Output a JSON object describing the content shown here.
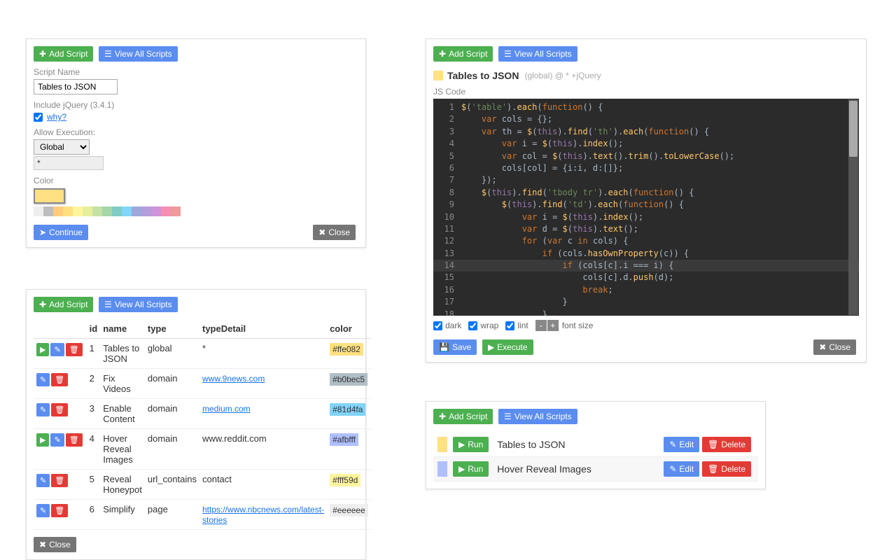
{
  "common": {
    "add_script": "Add Script",
    "view_all_scripts": "View All Scripts",
    "close": "Close",
    "save": "Save",
    "execute": "Execute",
    "continue": "Continue",
    "run": "Run",
    "edit": "Edit",
    "delete": "Delete"
  },
  "panel1": {
    "script_name_label": "Script Name",
    "script_name_value": "Tables to JSON",
    "include_jquery_label": "Include jQuery (3.4.1)",
    "include_jquery_checked": true,
    "why_link": "why?",
    "allow_execution_label": "Allow Execution:",
    "allow_execution_value": "Global",
    "type_detail_value": "*",
    "color_label": "Color",
    "selected_color": "#ffe082",
    "palette": [
      "#eeeeee",
      "#bdbdbd",
      "#ffcc80",
      "#ffe082",
      "#fff59d",
      "#e6ee9c",
      "#c5e1a5",
      "#a5d6a7",
      "#80cbc4",
      "#81d4fa",
      "#9fa8da",
      "#b39ddb",
      "#ce93d8",
      "#f48fb1",
      "#ef9a9a"
    ]
  },
  "panel2": {
    "headers": {
      "id": "id",
      "name": "name",
      "type": "type",
      "typeDetail": "typeDetail",
      "color": "color"
    },
    "rows": [
      {
        "play": true,
        "id": "1",
        "name": "Tables to JSON",
        "type": "global",
        "typeDetail": "*",
        "typeDetailLink": false,
        "color": "#ffe082"
      },
      {
        "play": false,
        "id": "2",
        "name": "Fix Videos",
        "type": "domain",
        "typeDetail": "www.9news.com",
        "typeDetailLink": true,
        "color": "#b0bec5"
      },
      {
        "play": false,
        "id": "3",
        "name": "Enable Content",
        "type": "domain",
        "typeDetail": "medium.com",
        "typeDetailLink": true,
        "color": "#81d4fa"
      },
      {
        "play": true,
        "id": "4",
        "name": "Hover Reveal Images",
        "type": "domain",
        "typeDetail": "www.reddit.com",
        "typeDetailLink": false,
        "color": "#afbfff"
      },
      {
        "play": false,
        "id": "5",
        "name": "Reveal Honeypot",
        "type": "url_contains",
        "typeDetail": "contact",
        "typeDetailLink": false,
        "color": "#fff59d"
      },
      {
        "play": false,
        "id": "6",
        "name": "Simplify",
        "type": "page",
        "typeDetail": "https://www.nbcnews.com/latest-stories",
        "typeDetailLink": true,
        "color": "#eeeeee"
      }
    ]
  },
  "panel3": {
    "title": "Tables to JSON",
    "meta": "(global) @ * +jQuery",
    "js_code_label": "JS Code",
    "options": {
      "dark": "dark",
      "wrap": "wrap",
      "lint": "lint",
      "font_size": "font size",
      "minus": "-",
      "plus": "+"
    },
    "options_checked": {
      "dark": true,
      "wrap": true,
      "lint": true
    },
    "code_lines": [
      [
        [
          "fn",
          "$"
        ],
        [
          "op",
          "("
        ],
        [
          "str",
          "'table'"
        ],
        [
          "op",
          ")."
        ],
        [
          "fn",
          "each"
        ],
        [
          "op",
          "("
        ],
        [
          "kw",
          "function"
        ],
        [
          "op",
          "() {"
        ]
      ],
      [
        [
          "sp",
          "    "
        ],
        [
          "kw",
          "var"
        ],
        [
          "op",
          " cols = {};"
        ]
      ],
      [
        [
          "sp",
          "    "
        ],
        [
          "kw",
          "var"
        ],
        [
          "op",
          " th = "
        ],
        [
          "fn",
          "$"
        ],
        [
          "op",
          "("
        ],
        [
          "this",
          "this"
        ],
        [
          "op",
          ")."
        ],
        [
          "fn",
          "find"
        ],
        [
          "op",
          "("
        ],
        [
          "str",
          "'th'"
        ],
        [
          "op",
          ")."
        ],
        [
          "fn",
          "each"
        ],
        [
          "op",
          "("
        ],
        [
          "kw",
          "function"
        ],
        [
          "op",
          "() {"
        ]
      ],
      [
        [
          "sp",
          "        "
        ],
        [
          "kw",
          "var"
        ],
        [
          "op",
          " i = "
        ],
        [
          "fn",
          "$"
        ],
        [
          "op",
          "("
        ],
        [
          "this",
          "this"
        ],
        [
          "op",
          ")."
        ],
        [
          "fn",
          "index"
        ],
        [
          "op",
          "();"
        ]
      ],
      [
        [
          "sp",
          "        "
        ],
        [
          "kw",
          "var"
        ],
        [
          "op",
          " col = "
        ],
        [
          "fn",
          "$"
        ],
        [
          "op",
          "("
        ],
        [
          "this",
          "this"
        ],
        [
          "op",
          ")."
        ],
        [
          "fn",
          "text"
        ],
        [
          "op",
          "()."
        ],
        [
          "fn",
          "trim"
        ],
        [
          "op",
          "()."
        ],
        [
          "fn",
          "toLowerCase"
        ],
        [
          "op",
          "();"
        ]
      ],
      [
        [
          "sp",
          "        "
        ],
        [
          "op",
          "cols[col] = {i:i, d:[]};"
        ]
      ],
      [
        [
          "sp",
          "    "
        ],
        [
          "op",
          "});"
        ]
      ],
      [
        [
          "sp",
          "    "
        ],
        [
          "fn",
          "$"
        ],
        [
          "op",
          "("
        ],
        [
          "this",
          "this"
        ],
        [
          "op",
          ")."
        ],
        [
          "fn",
          "find"
        ],
        [
          "op",
          "("
        ],
        [
          "str",
          "'tbody tr'"
        ],
        [
          "op",
          ")."
        ],
        [
          "fn",
          "each"
        ],
        [
          "op",
          "("
        ],
        [
          "kw",
          "function"
        ],
        [
          "op",
          "() {"
        ]
      ],
      [
        [
          "sp",
          "        "
        ],
        [
          "fn",
          "$"
        ],
        [
          "op",
          "("
        ],
        [
          "this",
          "this"
        ],
        [
          "op",
          ")."
        ],
        [
          "fn",
          "find"
        ],
        [
          "op",
          "("
        ],
        [
          "str",
          "'td'"
        ],
        [
          "op",
          ")."
        ],
        [
          "fn",
          "each"
        ],
        [
          "op",
          "("
        ],
        [
          "kw",
          "function"
        ],
        [
          "op",
          "() {"
        ]
      ],
      [
        [
          "sp",
          "            "
        ],
        [
          "kw",
          "var"
        ],
        [
          "op",
          " i = "
        ],
        [
          "fn",
          "$"
        ],
        [
          "op",
          "("
        ],
        [
          "this",
          "this"
        ],
        [
          "op",
          ")."
        ],
        [
          "fn",
          "index"
        ],
        [
          "op",
          "();"
        ]
      ],
      [
        [
          "sp",
          "            "
        ],
        [
          "kw",
          "var"
        ],
        [
          "op",
          " d = "
        ],
        [
          "fn",
          "$"
        ],
        [
          "op",
          "("
        ],
        [
          "this",
          "this"
        ],
        [
          "op",
          ")."
        ],
        [
          "fn",
          "text"
        ],
        [
          "op",
          "();"
        ]
      ],
      [
        [
          "sp",
          "            "
        ],
        [
          "kw",
          "for"
        ],
        [
          "op",
          " ("
        ],
        [
          "kw",
          "var"
        ],
        [
          "op",
          " c "
        ],
        [
          "kw",
          "in"
        ],
        [
          "op",
          " cols) {"
        ]
      ],
      [
        [
          "sp",
          "                "
        ],
        [
          "kw",
          "if"
        ],
        [
          "op",
          " (cols."
        ],
        [
          "fn",
          "hasOwnProperty"
        ],
        [
          "op",
          "(c)) {"
        ]
      ],
      [
        [
          "sp",
          "                    "
        ],
        [
          "kw",
          "if"
        ],
        [
          "op",
          " (cols[c].i === i) {"
        ]
      ],
      [
        [
          "sp",
          "                        "
        ],
        [
          "op",
          "cols[c].d."
        ],
        [
          "fn",
          "push"
        ],
        [
          "op",
          "(d);"
        ]
      ],
      [
        [
          "sp",
          "                        "
        ],
        [
          "kw",
          "break"
        ],
        [
          "op",
          ";"
        ]
      ],
      [
        [
          "sp",
          "                    "
        ],
        [
          "op",
          "}"
        ]
      ],
      [
        [
          "sp",
          "                "
        ],
        [
          "op",
          "}"
        ]
      ],
      [
        [
          "sp",
          "            "
        ],
        [
          "op",
          "}"
        ]
      ],
      [
        [
          "sp",
          "        "
        ],
        [
          "op",
          "});"
        ]
      ],
      [
        [
          "sp",
          "    "
        ],
        [
          "op",
          "});"
        ]
      ]
    ],
    "highlight_line": 14
  },
  "panel4": {
    "rows": [
      {
        "color": "#ffe082",
        "name": "Tables to JSON"
      },
      {
        "color": "#afbfff",
        "name": "Hover Reveal Images"
      }
    ]
  }
}
